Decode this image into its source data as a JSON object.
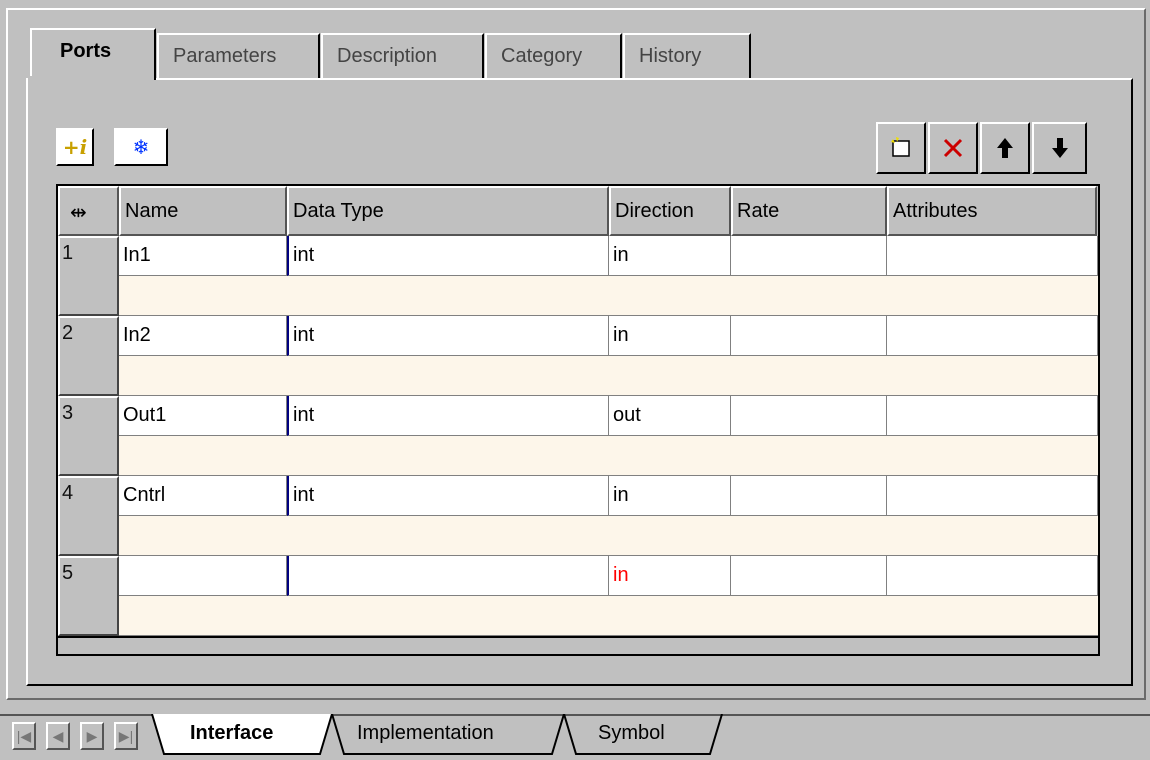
{
  "top_tabs": [
    {
      "label": "Ports",
      "active": true
    },
    {
      "label": "Parameters",
      "active": false
    },
    {
      "label": "Description",
      "active": false
    },
    {
      "label": "Category",
      "active": false
    },
    {
      "label": "History",
      "active": false
    }
  ],
  "toolbar": {
    "left_icons": [
      "add-italic-icon",
      "snowflake-icon"
    ],
    "right_icons": [
      "new-row-icon",
      "delete-icon",
      "move-up-icon",
      "move-down-icon"
    ]
  },
  "table": {
    "resize_glyph": "⇹",
    "columns": [
      "Name",
      "Data Type",
      "Direction",
      "Rate",
      "Attributes"
    ],
    "rows": [
      {
        "num": "1",
        "name": "In1",
        "type": "int",
        "direction": "in",
        "rate": "",
        "attributes": ""
      },
      {
        "num": "2",
        "name": "In2",
        "type": "int",
        "direction": "in",
        "rate": "",
        "attributes": ""
      },
      {
        "num": "3",
        "name": "Out1",
        "type": "int",
        "direction": "out",
        "rate": "",
        "attributes": ""
      },
      {
        "num": "4",
        "name": "Cntrl",
        "type": "int",
        "direction": "in",
        "rate": "",
        "attributes": ""
      },
      {
        "num": "5",
        "name": "",
        "type": "",
        "direction": "in",
        "rate": "",
        "attributes": ""
      }
    ]
  },
  "bottom_tabs": [
    {
      "label": "Interface",
      "active": true
    },
    {
      "label": "Implementation",
      "active": false
    },
    {
      "label": "Symbol",
      "active": false
    }
  ],
  "colors": {
    "placeholder_direction": "#ff0000",
    "note_row": "#fdf6ea",
    "face": "#c0c0c0"
  }
}
